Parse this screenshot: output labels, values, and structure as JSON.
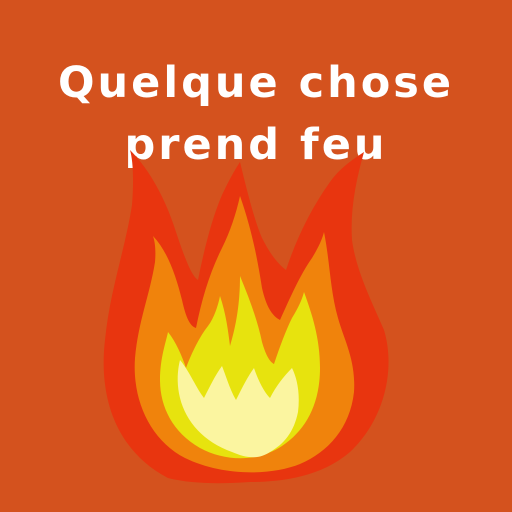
{
  "title": {
    "line1": "Quelque chose",
    "line2": "prend feu"
  },
  "illustration": {
    "icon": "fire-icon",
    "colors": {
      "background": "#d4521e",
      "outer": "#e8350f",
      "middle": "#f0830c",
      "inner": "#e7e30e",
      "core": "#fbf5a0"
    }
  }
}
